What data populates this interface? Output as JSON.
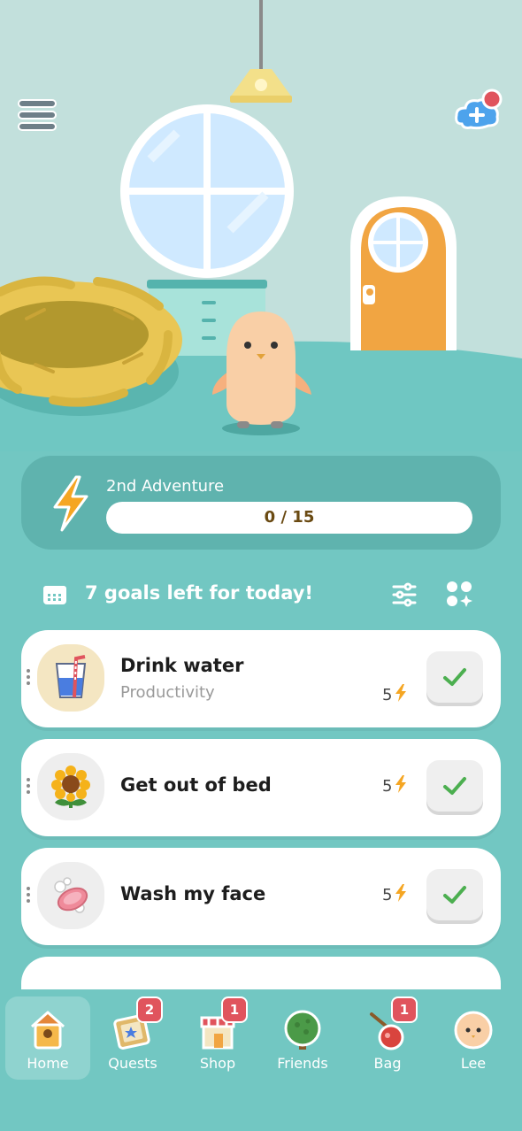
{
  "adventure": {
    "title": "2nd Adventure",
    "progress_text": "0 / 15",
    "progress": 0
  },
  "goals_header": {
    "text": "7 goals left for today!"
  },
  "goals": [
    {
      "name": "Drink water",
      "category": "Productivity",
      "points": "5",
      "icon": "water-glass-icon"
    },
    {
      "name": "Get out of bed",
      "category": "",
      "points": "5",
      "icon": "sunflower-icon"
    },
    {
      "name": "Wash my face",
      "category": "",
      "points": "5",
      "icon": "soap-icon"
    }
  ],
  "tabs": [
    {
      "label": "Home",
      "icon": "birdhouse-icon",
      "badge": ""
    },
    {
      "label": "Quests",
      "icon": "quest-board-icon",
      "badge": "2"
    },
    {
      "label": "Shop",
      "icon": "shop-icon",
      "badge": "1"
    },
    {
      "label": "Friends",
      "icon": "tree-icon",
      "badge": ""
    },
    {
      "label": "Bag",
      "icon": "bag-icon",
      "badge": "1"
    },
    {
      "label": "Lee",
      "icon": "avatar-icon",
      "badge": ""
    }
  ],
  "colors": {
    "accent": "#f5a623",
    "teal": "#72c7c2",
    "check": "#4caf50",
    "badge": "#e0545d"
  }
}
